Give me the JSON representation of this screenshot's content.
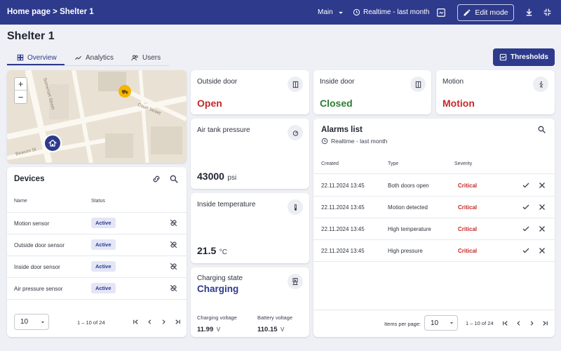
{
  "header": {
    "breadcrumb": "Home page > Shelter 1",
    "dashboard_state": "Main",
    "timewindow": "Realtime - last month",
    "edit_mode_label": "Edit mode"
  },
  "page": {
    "title": "Shelter 1",
    "tabs": [
      {
        "label": "Overview"
      },
      {
        "label": "Analytics"
      },
      {
        "label": "Users"
      }
    ],
    "thresholds_label": "Thresholds"
  },
  "map": {
    "zoom_in": "+",
    "zoom_out": "−",
    "streets": [
      "Somerset Street",
      "Court Street",
      "Beacon St"
    ]
  },
  "devices": {
    "title": "Devices",
    "columns": [
      "Name",
      "Status"
    ],
    "rows": [
      {
        "name": "Motion sensor",
        "status": "Active"
      },
      {
        "name": "Outside door sensor",
        "status": "Active"
      },
      {
        "name": "Inside door sensor",
        "status": "Active"
      },
      {
        "name": "Air pressure sensor",
        "status": "Active"
      }
    ],
    "page_size": "10",
    "range": "1 – 10 of 24"
  },
  "cards": {
    "outside_door": {
      "label": "Outside door",
      "value": "Open",
      "color": "#c62828"
    },
    "inside_door": {
      "label": "Inside door",
      "value": "Closed",
      "color": "#2e7d32"
    },
    "motion": {
      "label": "Motion",
      "value": "Motion",
      "color": "#c62828"
    },
    "air_tank": {
      "label": "Air tank pressure",
      "value": "43000",
      "unit": "psi"
    },
    "inside_temp": {
      "label": "Inside temperature",
      "value": "21.5",
      "unit": "°C"
    },
    "charging": {
      "label": "Charging state",
      "value": "Charging",
      "voltage_label": "Charging voltage",
      "voltage_value": "11.99",
      "voltage_unit": "V",
      "battery_label": "Battery voltage",
      "battery_value": "110.15",
      "battery_unit": "V"
    }
  },
  "alarms": {
    "title": "Alarms list",
    "subtitle": "Realtime - last month",
    "columns": [
      "Created",
      "Type",
      "Severity"
    ],
    "rows": [
      {
        "created": "22.11.2024 13:45",
        "type": "Both doors open",
        "severity": "Critical"
      },
      {
        "created": "22.11.2024 13:45",
        "type": "Motion detected",
        "severity": "Critical"
      },
      {
        "created": "22.11.2024 13:45",
        "type": "High temperature",
        "severity": "Critical"
      },
      {
        "created": "22.11.2024 13:45",
        "type": "High pressure",
        "severity": "Critical"
      }
    ],
    "items_per_page_label": "Items per page:",
    "page_size": "10",
    "range": "1 – 10 of 24"
  },
  "colors": {
    "primary": "#2e3a8c",
    "critical": "#c62828",
    "ok": "#2e7d32",
    "background": "#eef0f5"
  },
  "icons": [
    "dashboard-icon",
    "chart-line-icon",
    "users-icon",
    "clock-icon",
    "edit-icon",
    "download-icon",
    "fullscreen-exit-icon",
    "door-icon",
    "walk-icon",
    "gauge-icon",
    "thermometer-icon",
    "charging-station-icon",
    "search-icon",
    "link-icon",
    "link-off-icon",
    "check-icon",
    "close-icon",
    "home-pin-icon",
    "truck-pin-icon"
  ]
}
